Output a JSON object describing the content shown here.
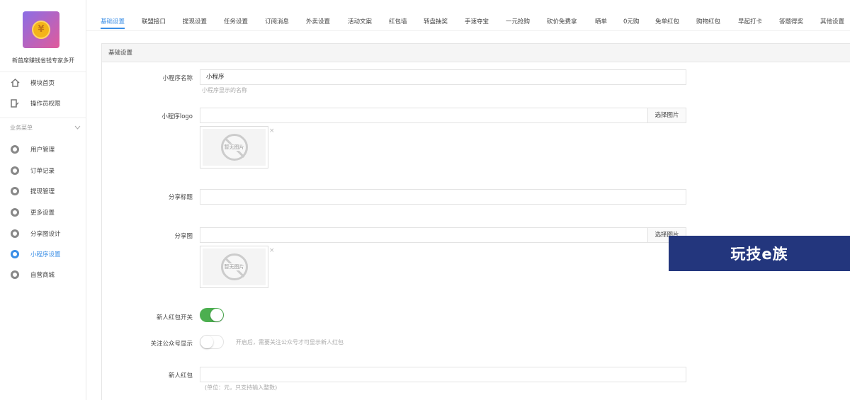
{
  "app": {
    "name": "新首席赚钱省钱专家多开",
    "logo_symbol": "¥"
  },
  "sidebar": {
    "top_items": [
      {
        "label": "模块首页",
        "icon": "home-icon"
      },
      {
        "label": "操作员权限",
        "icon": "user-edit-icon"
      }
    ],
    "section_title": "业务菜单",
    "items": [
      {
        "label": "用户管理",
        "icon": "gear-icon"
      },
      {
        "label": "订单记录",
        "icon": "gear-icon"
      },
      {
        "label": "提现管理",
        "icon": "gear-icon"
      },
      {
        "label": "更多设置",
        "icon": "gear-icon"
      },
      {
        "label": "分享图设计",
        "icon": "gear-icon"
      },
      {
        "label": "小程序设置",
        "icon": "gear-icon",
        "active": true
      },
      {
        "label": "自营商城",
        "icon": "gear-icon"
      }
    ]
  },
  "tabs": [
    "基础设置",
    "联盟接口",
    "提现设置",
    "任务设置",
    "订阅消息",
    "外卖设置",
    "活动文案",
    "红包墙",
    "转盘抽奖",
    "手速夺宝",
    "一元抢购",
    "砍价免费拿",
    "晒单",
    "0元购",
    "免单红包",
    "购物红包",
    "早起打卡",
    "答题得奖",
    "其他设置"
  ],
  "active_tab": "基础设置",
  "panel": {
    "title": "基础设置",
    "fields": {
      "app_name_label": "小程序名称",
      "app_name_value": "小程序",
      "app_name_help": "小程序显示的名称",
      "logo_label": "小程序logo",
      "select_image": "选择图片",
      "no_image": "暂无图片",
      "close_mark": "×",
      "share_title_label": "分享标题",
      "share_image_label": "分享图",
      "newbie_switch_label": "新人红包开关",
      "follow_label": "关注公众号显示",
      "follow_help": "开启后，需要关注公众号才可显示新人红包",
      "newbie_packet_label": "新人红包",
      "newbie_packet_help": "(单位：元，只支持输入整数)"
    },
    "newbie_switch_on": true,
    "follow_switch_on": false
  },
  "watermark": "玩技e族",
  "colors": {
    "accent": "#3a8ee6",
    "switch_on": "#4caf50",
    "watermark_bg": "#23367d"
  }
}
